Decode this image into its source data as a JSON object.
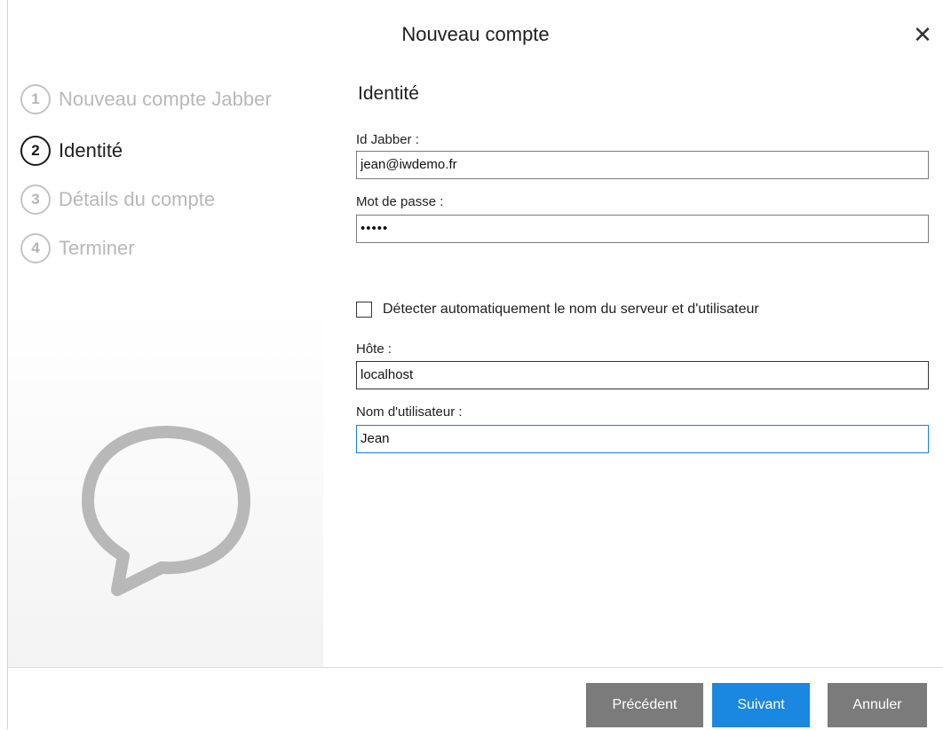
{
  "window": {
    "title": "Nouveau compte",
    "close_icon": "close-icon"
  },
  "steps": [
    {
      "number": "1",
      "label": "Nouveau compte Jabber",
      "state": "inactive"
    },
    {
      "number": "2",
      "label": "Identité",
      "state": "active"
    },
    {
      "number": "3",
      "label": "Détails du compte",
      "state": "inactive"
    },
    {
      "number": "4",
      "label": "Terminer",
      "state": "inactive"
    }
  ],
  "sidebar": {
    "illustration_icon": "chat-bubble-icon"
  },
  "form": {
    "section_title": "Identité",
    "jabber_id": {
      "label": "Id Jabber :",
      "value": "jean@iwdemo.fr"
    },
    "password": {
      "label": "Mot de passe :",
      "value": "•••••"
    },
    "auto_detect": {
      "label": "Détecter automatiquement le nom du serveur et d'utilisateur",
      "checked": false
    },
    "host": {
      "label": "Hôte :",
      "value": "localhost"
    },
    "username": {
      "label": "Nom d'utilisateur :",
      "value": "Jean"
    }
  },
  "buttons": {
    "previous": "Précédent",
    "next": "Suivant",
    "cancel": "Annuler"
  },
  "colors": {
    "accent": "#1a88e0",
    "button_gray": "#7b7b7b",
    "inactive_text": "#b8b8b8"
  }
}
